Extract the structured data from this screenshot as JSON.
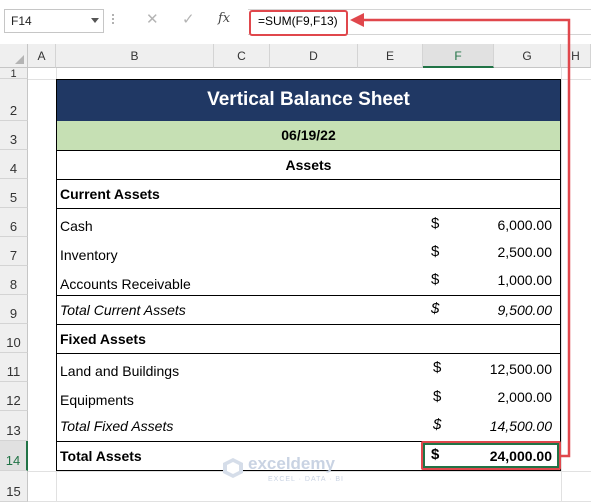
{
  "formula_bar": {
    "name_box": "F14",
    "cancel_icon": "✕",
    "enter_icon": "✓",
    "fx_label": "fx",
    "formula": "=SUM(F9,F13)"
  },
  "columns": [
    "A",
    "B",
    "C",
    "D",
    "E",
    "F",
    "G",
    "H"
  ],
  "rows": [
    "1",
    "2",
    "3",
    "4",
    "5",
    "6",
    "7",
    "8",
    "9",
    "10",
    "11",
    "12",
    "13",
    "14",
    "15"
  ],
  "sheet": {
    "title": "Vertical Balance Sheet",
    "date": "06/19/22",
    "section": "Assets",
    "current_assets_header": "Current Assets",
    "cash_label": "Cash",
    "cash_dollar": "$",
    "cash_value": "6,000.00",
    "inventory_label": "Inventory",
    "inventory_dollar": "$",
    "inventory_value": "2,500.00",
    "ar_label": "Accounts Receivable",
    "ar_dollar": "$",
    "ar_value": "1,000.00",
    "total_current_label": "Total Current Assets",
    "total_current_dollar": "$",
    "total_current_value": "9,500.00",
    "fixed_assets_header": "Fixed Assets",
    "land_label": "Land and Buildings",
    "land_dollar": "$",
    "land_value": "12,500.00",
    "equip_label": "Equipments",
    "equip_dollar": "$",
    "equip_value": "2,000.00",
    "total_fixed_label": "Total Fixed Assets",
    "total_fixed_dollar": "$",
    "total_fixed_value": "14,500.00",
    "total_assets_label": "Total Assets",
    "total_assets_dollar": "$",
    "total_assets_value": "24,000.00"
  },
  "watermark": {
    "name": "exceldemy",
    "tagline": "EXCEL · DATA · BI"
  },
  "colors": {
    "title_bg": "#203864",
    "date_bg": "#c6e0b4",
    "highlight": "#e0474c",
    "selection": "#217346"
  }
}
